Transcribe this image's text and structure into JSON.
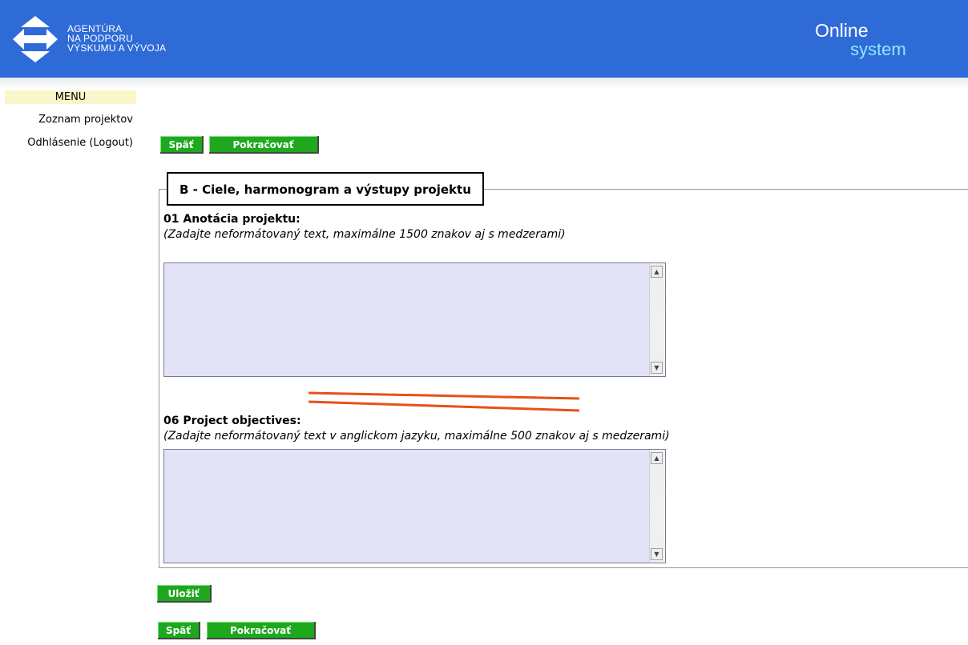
{
  "header": {
    "org_line1": "AGENTÚRA",
    "org_line2": "NA PODPORU",
    "org_line3": "VÝSKUMU A VÝVOJA",
    "online": "Online",
    "system": "system",
    "logo_icon": "double-arrow-logo-icon",
    "bg_color": "#2f6bd7"
  },
  "sidebar": {
    "menu_title": "MENU",
    "items": [
      {
        "label": "Zoznam projektov"
      },
      {
        "label": "Odhlásenie (Logout)"
      }
    ]
  },
  "top_buttons": {
    "back": "Späť",
    "continue": "Pokračovať"
  },
  "section": {
    "legend": "B - Ciele, harmonogram a výstupy projektu",
    "field1": {
      "label": "01 Anotácia projektu:",
      "hint": "(Zadajte neformátovaný text, maximálne 1500 znakov aj s medzerami)",
      "value": ""
    },
    "field2": {
      "label": "06 Project objectives:",
      "hint": "(Zadajte neformátovaný text v anglickom jazyku, maximálne 500 znakov aj s medzerami)",
      "value": ""
    }
  },
  "bottom_buttons": {
    "save": "Uložiť",
    "back": "Späť",
    "continue": "Pokračovať"
  },
  "colors": {
    "button_green": "#1ea81e",
    "textarea_bg": "#e3e3f8",
    "menu_title_bg": "#f9f6c9",
    "annotation_orange": "#e8501a"
  }
}
